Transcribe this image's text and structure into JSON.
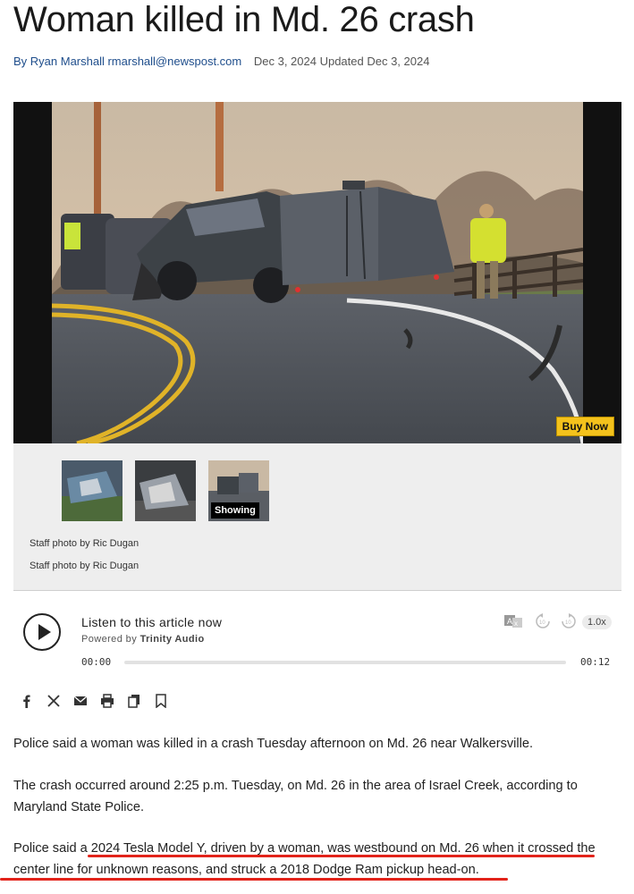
{
  "article": {
    "headline": "Woman killed in Md. 26 crash",
    "byline": {
      "author": "By Ryan Marshall rmarshall@newspost.com",
      "dates": "Dec 3, 2024 Updated Dec 3, 2024"
    }
  },
  "gallery": {
    "buy_now_label": "Buy Now",
    "showing_label": "Showing",
    "thumbnails": [
      {
        "name": "crash-photo-1"
      },
      {
        "name": "crash-photo-2"
      },
      {
        "name": "crash-photo-3"
      }
    ],
    "captions": [
      "Staff photo by Ric Dugan",
      "Staff photo by Ric Dugan"
    ]
  },
  "audio": {
    "title": "Listen to this article now",
    "powered_prefix": "Powered by",
    "powered_brand": "Trinity Audio",
    "current_time": "00:00",
    "duration": "00:12",
    "speed": "1.0x",
    "progress": 0,
    "icons": [
      "play-icon",
      "translate-icon",
      "rewind-icon",
      "forward-icon"
    ]
  },
  "share": {
    "icons": [
      "facebook-icon",
      "x-icon",
      "email-icon",
      "print-icon",
      "copy-icon",
      "bookmark-icon"
    ]
  },
  "body": {
    "p1": "Police said a woman was killed in a crash Tuesday afternoon on Md. 26 near Walkersville.",
    "p2_line1": "The crash occurred around 2:25 p.m. Tuesday, on Md. 26 in the area of Israel Creek, according to",
    "p2_line2": "Maryland State Police.",
    "p3_line1": "Police said a 2024 Tesla Model Y, driven by a woman, was westbound on Md. 26 when it crossed the",
    "p3_line2": "center line for unknown reasons, and struck a 2018 Dodge Ram pickup head-on."
  },
  "colors": {
    "highlight": "#e2231a",
    "buy_now": "#f4c21c",
    "author_link": "#1f4e8c"
  }
}
